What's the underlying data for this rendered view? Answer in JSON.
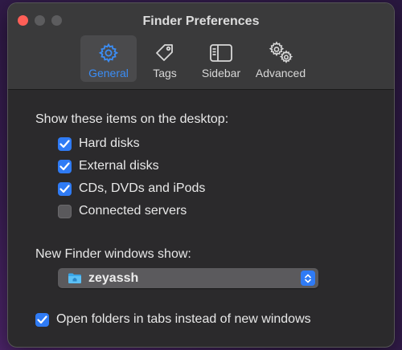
{
  "window": {
    "title": "Finder Preferences"
  },
  "toolbar": {
    "tabs": [
      {
        "label": "General",
        "icon": "gear-icon",
        "active": true
      },
      {
        "label": "Tags",
        "icon": "tag-icon",
        "active": false
      },
      {
        "label": "Sidebar",
        "icon": "sidebar-icon",
        "active": false
      },
      {
        "label": "Advanced",
        "icon": "gears-icon",
        "active": false
      }
    ]
  },
  "desktop_section": {
    "title": "Show these items on the desktop:",
    "items": [
      {
        "label": "Hard disks",
        "checked": true
      },
      {
        "label": "External disks",
        "checked": true
      },
      {
        "label": "CDs, DVDs and iPods",
        "checked": true
      },
      {
        "label": "Connected servers",
        "checked": false
      }
    ]
  },
  "new_window_section": {
    "title": "New Finder windows show:",
    "selected": "zeyassh"
  },
  "open_folders": {
    "label": "Open folders in tabs instead of new windows",
    "checked": true
  },
  "colors": {
    "accent": "#2f7bf5",
    "close": "#ff5f57"
  }
}
